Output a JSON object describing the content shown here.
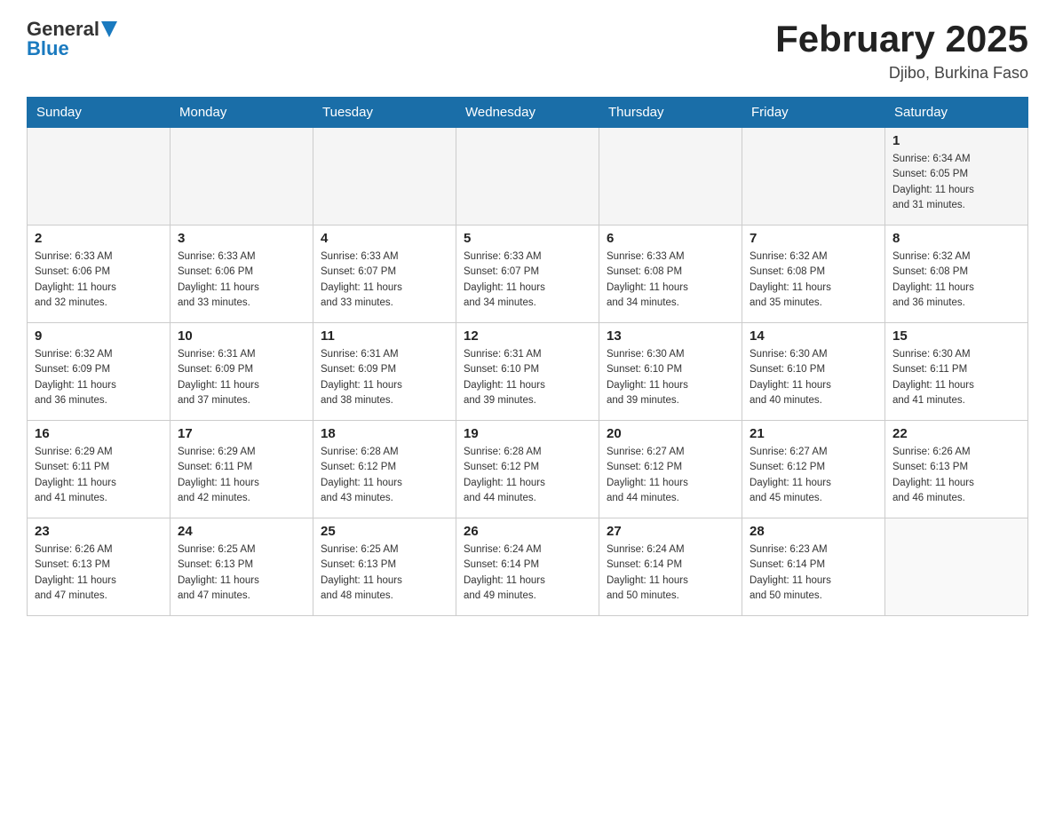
{
  "logo": {
    "general": "General",
    "blue": "Blue"
  },
  "title": "February 2025",
  "location": "Djibo, Burkina Faso",
  "days_of_week": [
    "Sunday",
    "Monday",
    "Tuesday",
    "Wednesday",
    "Thursday",
    "Friday",
    "Saturday"
  ],
  "weeks": [
    [
      {
        "day": "",
        "info": ""
      },
      {
        "day": "",
        "info": ""
      },
      {
        "day": "",
        "info": ""
      },
      {
        "day": "",
        "info": ""
      },
      {
        "day": "",
        "info": ""
      },
      {
        "day": "",
        "info": ""
      },
      {
        "day": "1",
        "info": "Sunrise: 6:34 AM\nSunset: 6:05 PM\nDaylight: 11 hours\nand 31 minutes."
      }
    ],
    [
      {
        "day": "2",
        "info": "Sunrise: 6:33 AM\nSunset: 6:06 PM\nDaylight: 11 hours\nand 32 minutes."
      },
      {
        "day": "3",
        "info": "Sunrise: 6:33 AM\nSunset: 6:06 PM\nDaylight: 11 hours\nand 33 minutes."
      },
      {
        "day": "4",
        "info": "Sunrise: 6:33 AM\nSunset: 6:07 PM\nDaylight: 11 hours\nand 33 minutes."
      },
      {
        "day": "5",
        "info": "Sunrise: 6:33 AM\nSunset: 6:07 PM\nDaylight: 11 hours\nand 34 minutes."
      },
      {
        "day": "6",
        "info": "Sunrise: 6:33 AM\nSunset: 6:08 PM\nDaylight: 11 hours\nand 34 minutes."
      },
      {
        "day": "7",
        "info": "Sunrise: 6:32 AM\nSunset: 6:08 PM\nDaylight: 11 hours\nand 35 minutes."
      },
      {
        "day": "8",
        "info": "Sunrise: 6:32 AM\nSunset: 6:08 PM\nDaylight: 11 hours\nand 36 minutes."
      }
    ],
    [
      {
        "day": "9",
        "info": "Sunrise: 6:32 AM\nSunset: 6:09 PM\nDaylight: 11 hours\nand 36 minutes."
      },
      {
        "day": "10",
        "info": "Sunrise: 6:31 AM\nSunset: 6:09 PM\nDaylight: 11 hours\nand 37 minutes."
      },
      {
        "day": "11",
        "info": "Sunrise: 6:31 AM\nSunset: 6:09 PM\nDaylight: 11 hours\nand 38 minutes."
      },
      {
        "day": "12",
        "info": "Sunrise: 6:31 AM\nSunset: 6:10 PM\nDaylight: 11 hours\nand 39 minutes."
      },
      {
        "day": "13",
        "info": "Sunrise: 6:30 AM\nSunset: 6:10 PM\nDaylight: 11 hours\nand 39 minutes."
      },
      {
        "day": "14",
        "info": "Sunrise: 6:30 AM\nSunset: 6:10 PM\nDaylight: 11 hours\nand 40 minutes."
      },
      {
        "day": "15",
        "info": "Sunrise: 6:30 AM\nSunset: 6:11 PM\nDaylight: 11 hours\nand 41 minutes."
      }
    ],
    [
      {
        "day": "16",
        "info": "Sunrise: 6:29 AM\nSunset: 6:11 PM\nDaylight: 11 hours\nand 41 minutes."
      },
      {
        "day": "17",
        "info": "Sunrise: 6:29 AM\nSunset: 6:11 PM\nDaylight: 11 hours\nand 42 minutes."
      },
      {
        "day": "18",
        "info": "Sunrise: 6:28 AM\nSunset: 6:12 PM\nDaylight: 11 hours\nand 43 minutes."
      },
      {
        "day": "19",
        "info": "Sunrise: 6:28 AM\nSunset: 6:12 PM\nDaylight: 11 hours\nand 44 minutes."
      },
      {
        "day": "20",
        "info": "Sunrise: 6:27 AM\nSunset: 6:12 PM\nDaylight: 11 hours\nand 44 minutes."
      },
      {
        "day": "21",
        "info": "Sunrise: 6:27 AM\nSunset: 6:12 PM\nDaylight: 11 hours\nand 45 minutes."
      },
      {
        "day": "22",
        "info": "Sunrise: 6:26 AM\nSunset: 6:13 PM\nDaylight: 11 hours\nand 46 minutes."
      }
    ],
    [
      {
        "day": "23",
        "info": "Sunrise: 6:26 AM\nSunset: 6:13 PM\nDaylight: 11 hours\nand 47 minutes."
      },
      {
        "day": "24",
        "info": "Sunrise: 6:25 AM\nSunset: 6:13 PM\nDaylight: 11 hours\nand 47 minutes."
      },
      {
        "day": "25",
        "info": "Sunrise: 6:25 AM\nSunset: 6:13 PM\nDaylight: 11 hours\nand 48 minutes."
      },
      {
        "day": "26",
        "info": "Sunrise: 6:24 AM\nSunset: 6:14 PM\nDaylight: 11 hours\nand 49 minutes."
      },
      {
        "day": "27",
        "info": "Sunrise: 6:24 AM\nSunset: 6:14 PM\nDaylight: 11 hours\nand 50 minutes."
      },
      {
        "day": "28",
        "info": "Sunrise: 6:23 AM\nSunset: 6:14 PM\nDaylight: 11 hours\nand 50 minutes."
      },
      {
        "day": "",
        "info": ""
      }
    ]
  ]
}
